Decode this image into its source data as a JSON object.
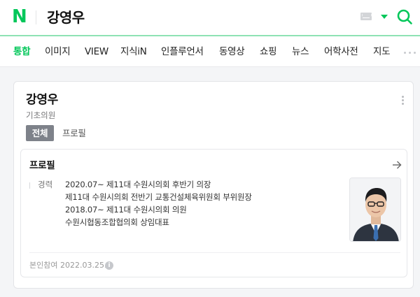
{
  "header": {
    "logo_text": "N",
    "query": "강영우",
    "accent_color": "#03c75a",
    "icons": [
      "keyboard-icon",
      "dropdown-caret-icon",
      "search-icon"
    ]
  },
  "tabs": [
    {
      "label": "통합",
      "active": true
    },
    {
      "label": "이미지"
    },
    {
      "label": "VIEW"
    },
    {
      "label": "지식iN"
    },
    {
      "label": "인플루언서"
    },
    {
      "label": "동영상"
    },
    {
      "label": "쇼핑"
    },
    {
      "label": "뉴스"
    },
    {
      "label": "어학사전"
    },
    {
      "label": "지도"
    }
  ],
  "person": {
    "name": "강영우",
    "role": "기초의원",
    "filters": [
      "전체",
      "프로필"
    ]
  },
  "profile": {
    "title": "프로필",
    "career_label": "경력",
    "career": [
      "2020.07~ 제11대 수원시의회 후반기 의장",
      "제11대 수원시의회 전반기 교통건설체육위원회 부위원장",
      "2018.07~ 제11대 수원시의회 의원",
      "수원시협동조합협의회 상임대표"
    ],
    "footnote": "본인참여 2022.03.25.",
    "info_symbol": "i"
  }
}
